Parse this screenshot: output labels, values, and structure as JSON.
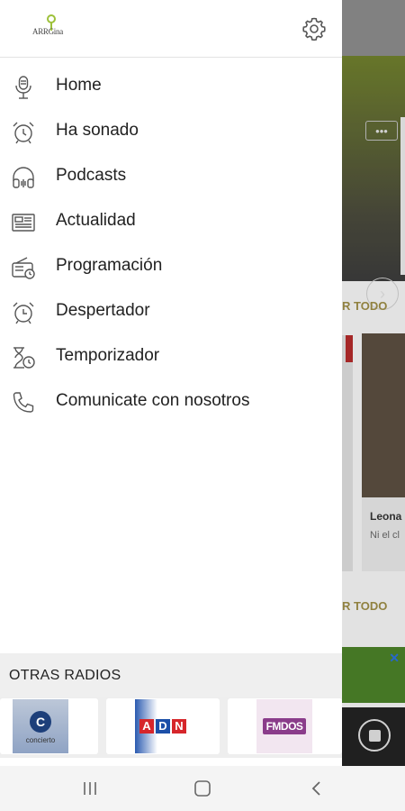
{
  "app": {
    "logo_text": "ARRGina"
  },
  "drawer": {
    "menu": [
      {
        "label": "Home",
        "icon": "microphone-icon"
      },
      {
        "label": "Ha sonado",
        "icon": "alarm-clock-icon"
      },
      {
        "label": "Podcasts",
        "icon": "headphones-icon"
      },
      {
        "label": "Actualidad",
        "icon": "newspaper-icon"
      },
      {
        "label": "Programación",
        "icon": "radio-schedule-icon"
      },
      {
        "label": "Despertador",
        "icon": "alarm-icon"
      },
      {
        "label": "Temporizador",
        "icon": "hourglass-timer-icon"
      },
      {
        "label": "Comunicate con nosotros",
        "icon": "phone-icon"
      }
    ],
    "other_radios": {
      "title": "OTRAS RADIOS",
      "stations": [
        {
          "name": "concierto",
          "logo_letter": "C",
          "logo_sub": "concierto"
        },
        {
          "name": "ADN",
          "letters": [
            "A",
            "D",
            "N"
          ]
        },
        {
          "name": "FMDOS",
          "logo_text": "FMDOS"
        }
      ]
    }
  },
  "background": {
    "ver_todo": "R TODO",
    "card_title": "Leona",
    "card_sub": "Ni el cl"
  },
  "colors": {
    "accent_green": "#9dc13a",
    "ver_todo": "#9a8a45"
  }
}
